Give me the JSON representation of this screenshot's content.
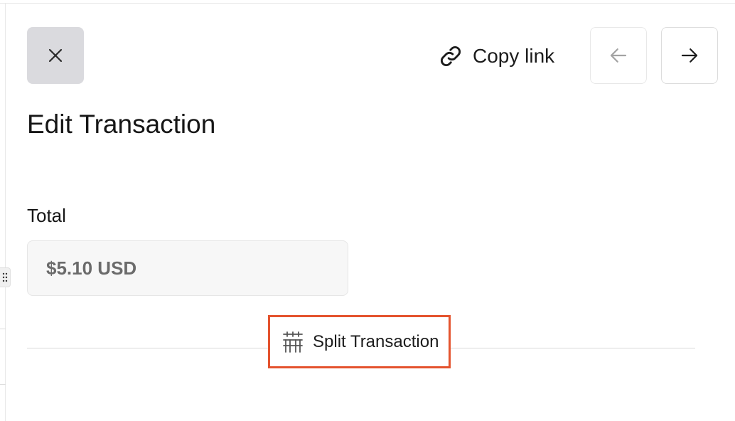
{
  "header": {
    "close_icon": "close-icon",
    "copy_link": {
      "label": "Copy link",
      "icon": "link-icon"
    },
    "prev_icon": "arrow-left-icon",
    "next_icon": "arrow-right-icon"
  },
  "page": {
    "title": "Edit Transaction"
  },
  "total": {
    "label": "Total",
    "value": "$5.10 USD"
  },
  "split": {
    "label": "Split Transaction",
    "icon": "split-icon",
    "highlight_color": "#e4532e"
  },
  "colors": {
    "close_button_bg": "#dadade",
    "field_bg": "#f7f7f7",
    "field_text": "#6b6b6b"
  }
}
